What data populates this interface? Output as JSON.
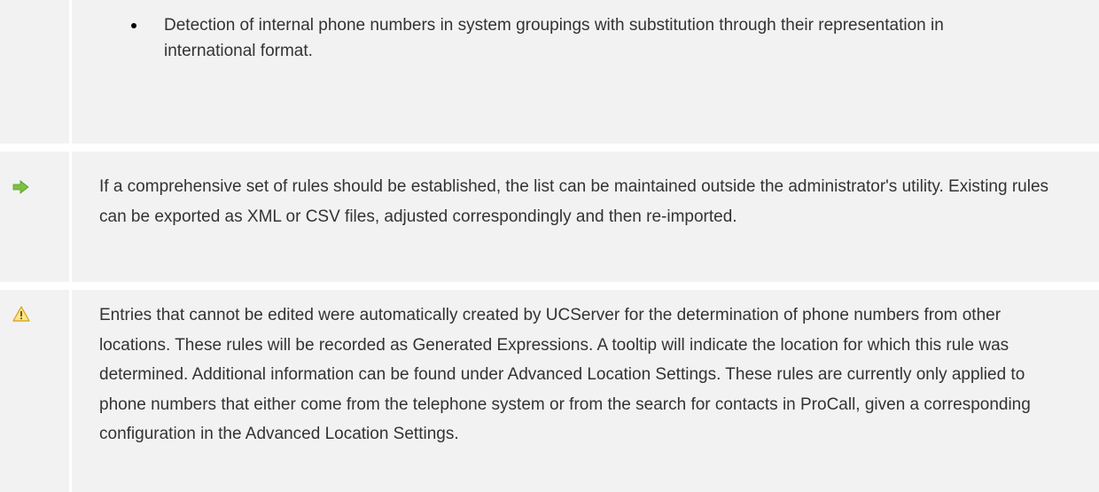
{
  "rows": [
    {
      "icon": "none",
      "bullet": "Detection of internal phone numbers in system groupings with substitution through their representation in international format."
    },
    {
      "icon": "arrow-right-icon",
      "icon_color": "#7ac142",
      "text": "If a comprehensive set of rules should be established, the list can be maintained outside the administrator's utility. Existing rules can be exported as XML or CSV files, adjusted correspondingly and then re-imported."
    },
    {
      "icon": "warning-icon",
      "icon_color": "#f5c400",
      "text": "Entries that cannot be edited were automatically created by UCServer for the determination of phone numbers from other locations. These rules will be recorded as Generated Expressions. A tooltip will indicate the location for which this rule was determined. Additional information can be found under Advanced Location Settings. These rules are currently only applied to phone numbers that either come from the telephone system or from the search for contacts in ProCall, given a corresponding configuration in the Advanced Location Settings."
    }
  ],
  "colors": {
    "row_background": "#f2f2f2",
    "text": "#333333",
    "separator": "#ffffff"
  }
}
